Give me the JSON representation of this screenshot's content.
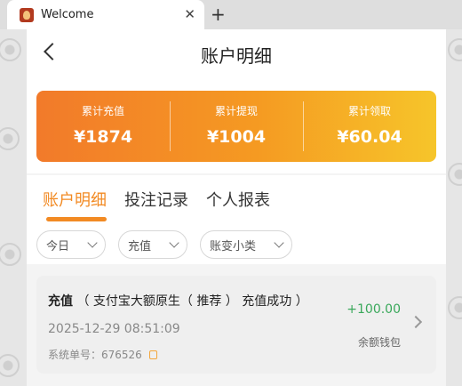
{
  "browser": {
    "tab_title": "Welcome",
    "close_glyph": "✕",
    "new_tab_glyph": "+"
  },
  "header": {
    "title": "账户明细"
  },
  "summary": {
    "items": [
      {
        "label": "累计充值",
        "value": "¥1874"
      },
      {
        "label": "累计提现",
        "value": "¥1004"
      },
      {
        "label": "累计领取",
        "value": "¥60.04"
      }
    ]
  },
  "tabs": [
    {
      "label": "账户明细",
      "active": true
    },
    {
      "label": "投注记录",
      "active": false
    },
    {
      "label": "个人报表",
      "active": false
    }
  ],
  "filters": [
    {
      "label": "今日"
    },
    {
      "label": "充值"
    },
    {
      "label": "账变小类"
    }
  ],
  "record": {
    "type": "充值",
    "detail": "（ 支付宝大额原生（ 推荐 ） 充值成功 ）",
    "datetime": "2025-12-29 08:51:09",
    "order": "系统单号：676526",
    "amount": "+100.00",
    "wallet": "余额钱包"
  },
  "colors": {
    "accent": "#f28a23",
    "positive": "#3aa85b",
    "gradient_start": "#f27a2a",
    "gradient_end": "#f6c52a"
  }
}
